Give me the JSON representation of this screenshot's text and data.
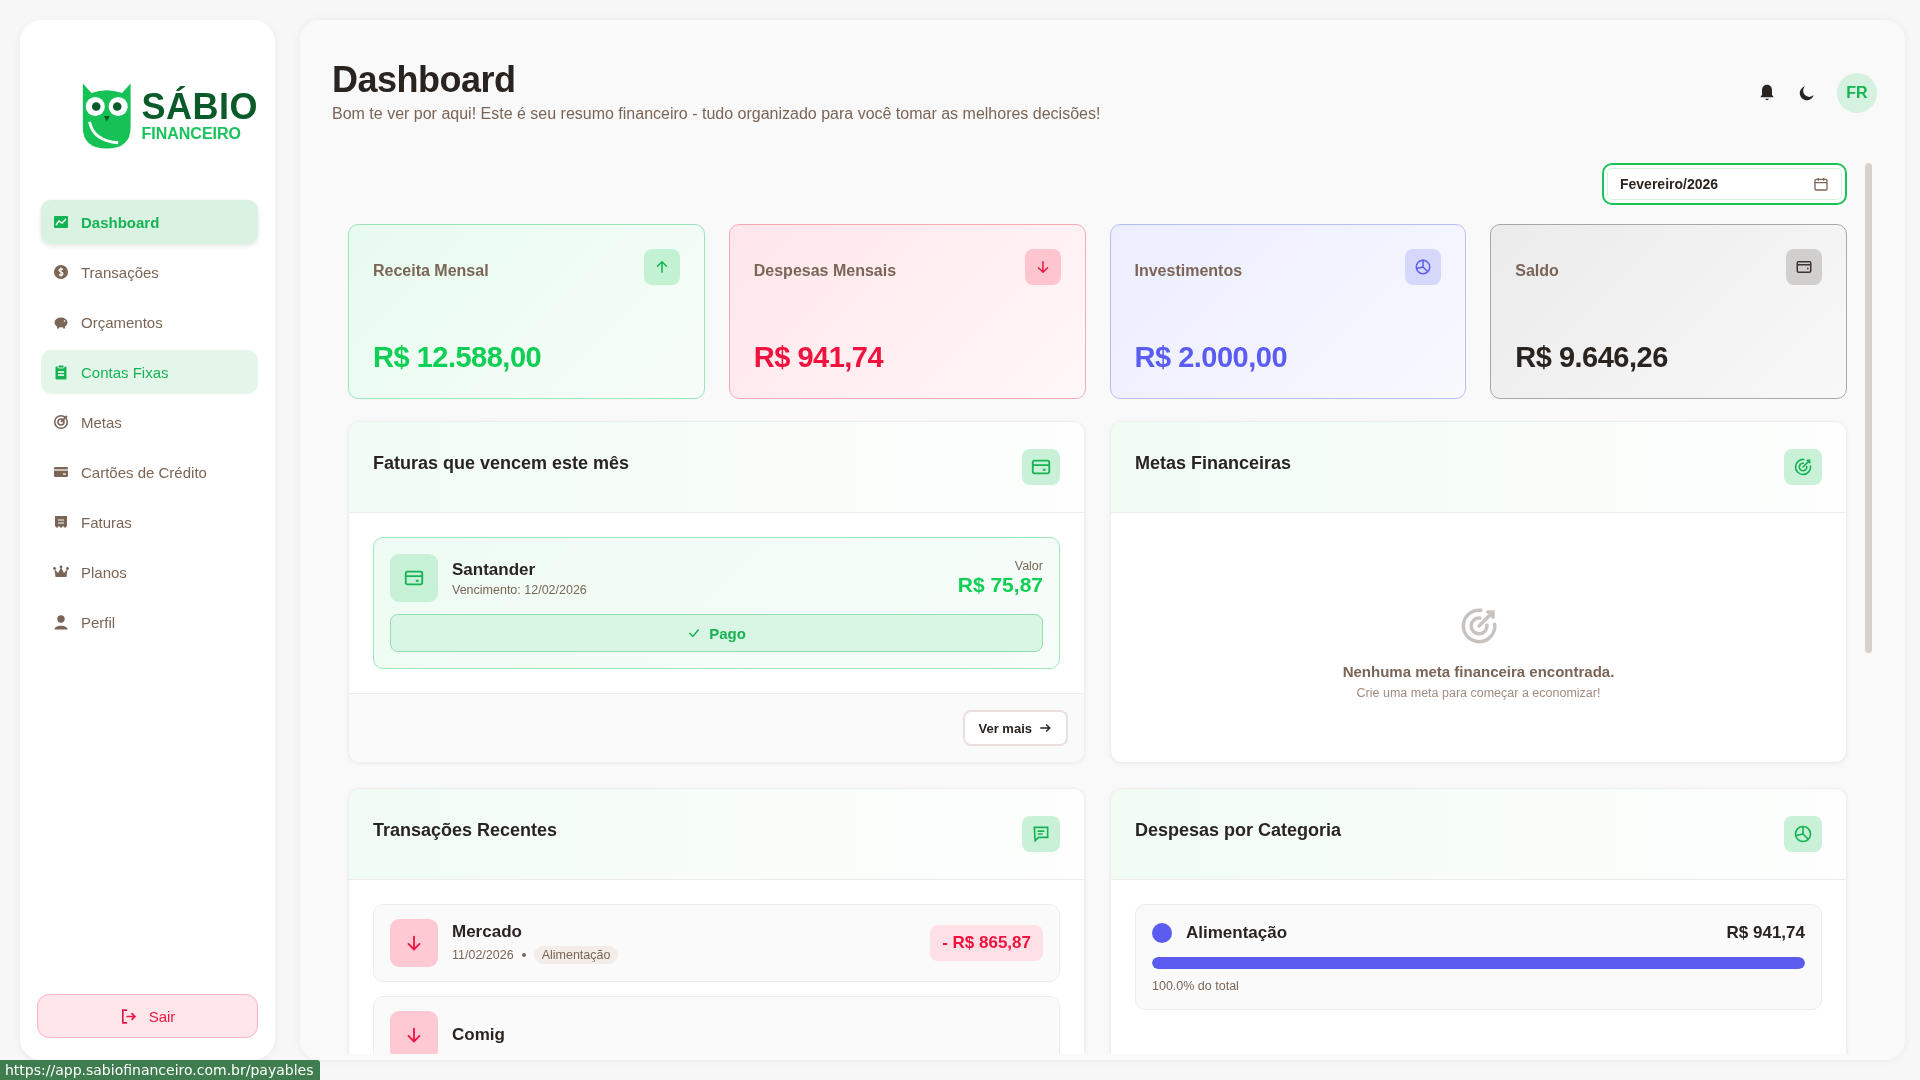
{
  "sidebar": {
    "logo": {
      "name": "SÁBIO",
      "tagline": "FINANCEIRO"
    },
    "items": [
      {
        "label": "Dashboard",
        "selected": true,
        "hovered": false
      },
      {
        "label": "Transações",
        "selected": false,
        "hovered": false
      },
      {
        "label": "Orçamentos",
        "selected": false,
        "hovered": false
      },
      {
        "label": "Contas Fixas",
        "selected": false,
        "hovered": true
      },
      {
        "label": "Metas",
        "selected": false,
        "hovered": false
      },
      {
        "label": "Cartões de Crédito",
        "selected": false,
        "hovered": false
      },
      {
        "label": "Faturas",
        "selected": false,
        "hovered": false
      },
      {
        "label": "Planos",
        "selected": false,
        "hovered": false
      },
      {
        "label": "Perfil",
        "selected": false,
        "hovered": false
      }
    ],
    "logout": "Sair"
  },
  "header": {
    "title": "Dashboard",
    "subtitle": "Bom te ver por aqui! Este é seu resumo financeiro - tudo organizado para você tomar as melhores decisões!",
    "avatar": "FR"
  },
  "period_field": {
    "value": "Fevereiro/2026"
  },
  "summary_cards": [
    {
      "label": "Receita Mensal",
      "value": "R$ 12.588,00"
    },
    {
      "label": "Despesas Mensais",
      "value": "R$ 941,74"
    },
    {
      "label": "Investimentos",
      "value": "R$ 2.000,00"
    },
    {
      "label": "Saldo",
      "value": "R$ 9.646,26"
    }
  ],
  "bills_panel": {
    "title": "Faturas que vencem este mês",
    "bills": [
      {
        "name": "Santander",
        "due": "Vencimento: 12/02/2026",
        "amount_label": "Valor",
        "amount": "R$ 75,87",
        "status": "Pago",
        "paid": true
      }
    ],
    "more_button": "Ver mais"
  },
  "goals_panel": {
    "title": "Metas Financeiras",
    "empty_title": "Nenhuma meta financeira encontrada.",
    "empty_hint": "Crie uma meta para começar a economizar!"
  },
  "transactions_panel": {
    "title": "Transações Recentes",
    "transactions": [
      {
        "name": "Mercado",
        "date": "11/02/2026",
        "category": "Alimentação",
        "amount": "- R$ 865,87",
        "kind": "expense"
      },
      {
        "name": "Comig",
        "kind": "expense"
      }
    ]
  },
  "categories_panel": {
    "title": "Despesas por Categoria",
    "categories": [
      {
        "name": "Alimentação",
        "color": "#5b5bf0",
        "amount": "R$ 941,74",
        "level": 1,
        "share": "100.0% do total"
      }
    ]
  },
  "status_url": "https://app.sabiofinanceiro.com.br/payables"
}
